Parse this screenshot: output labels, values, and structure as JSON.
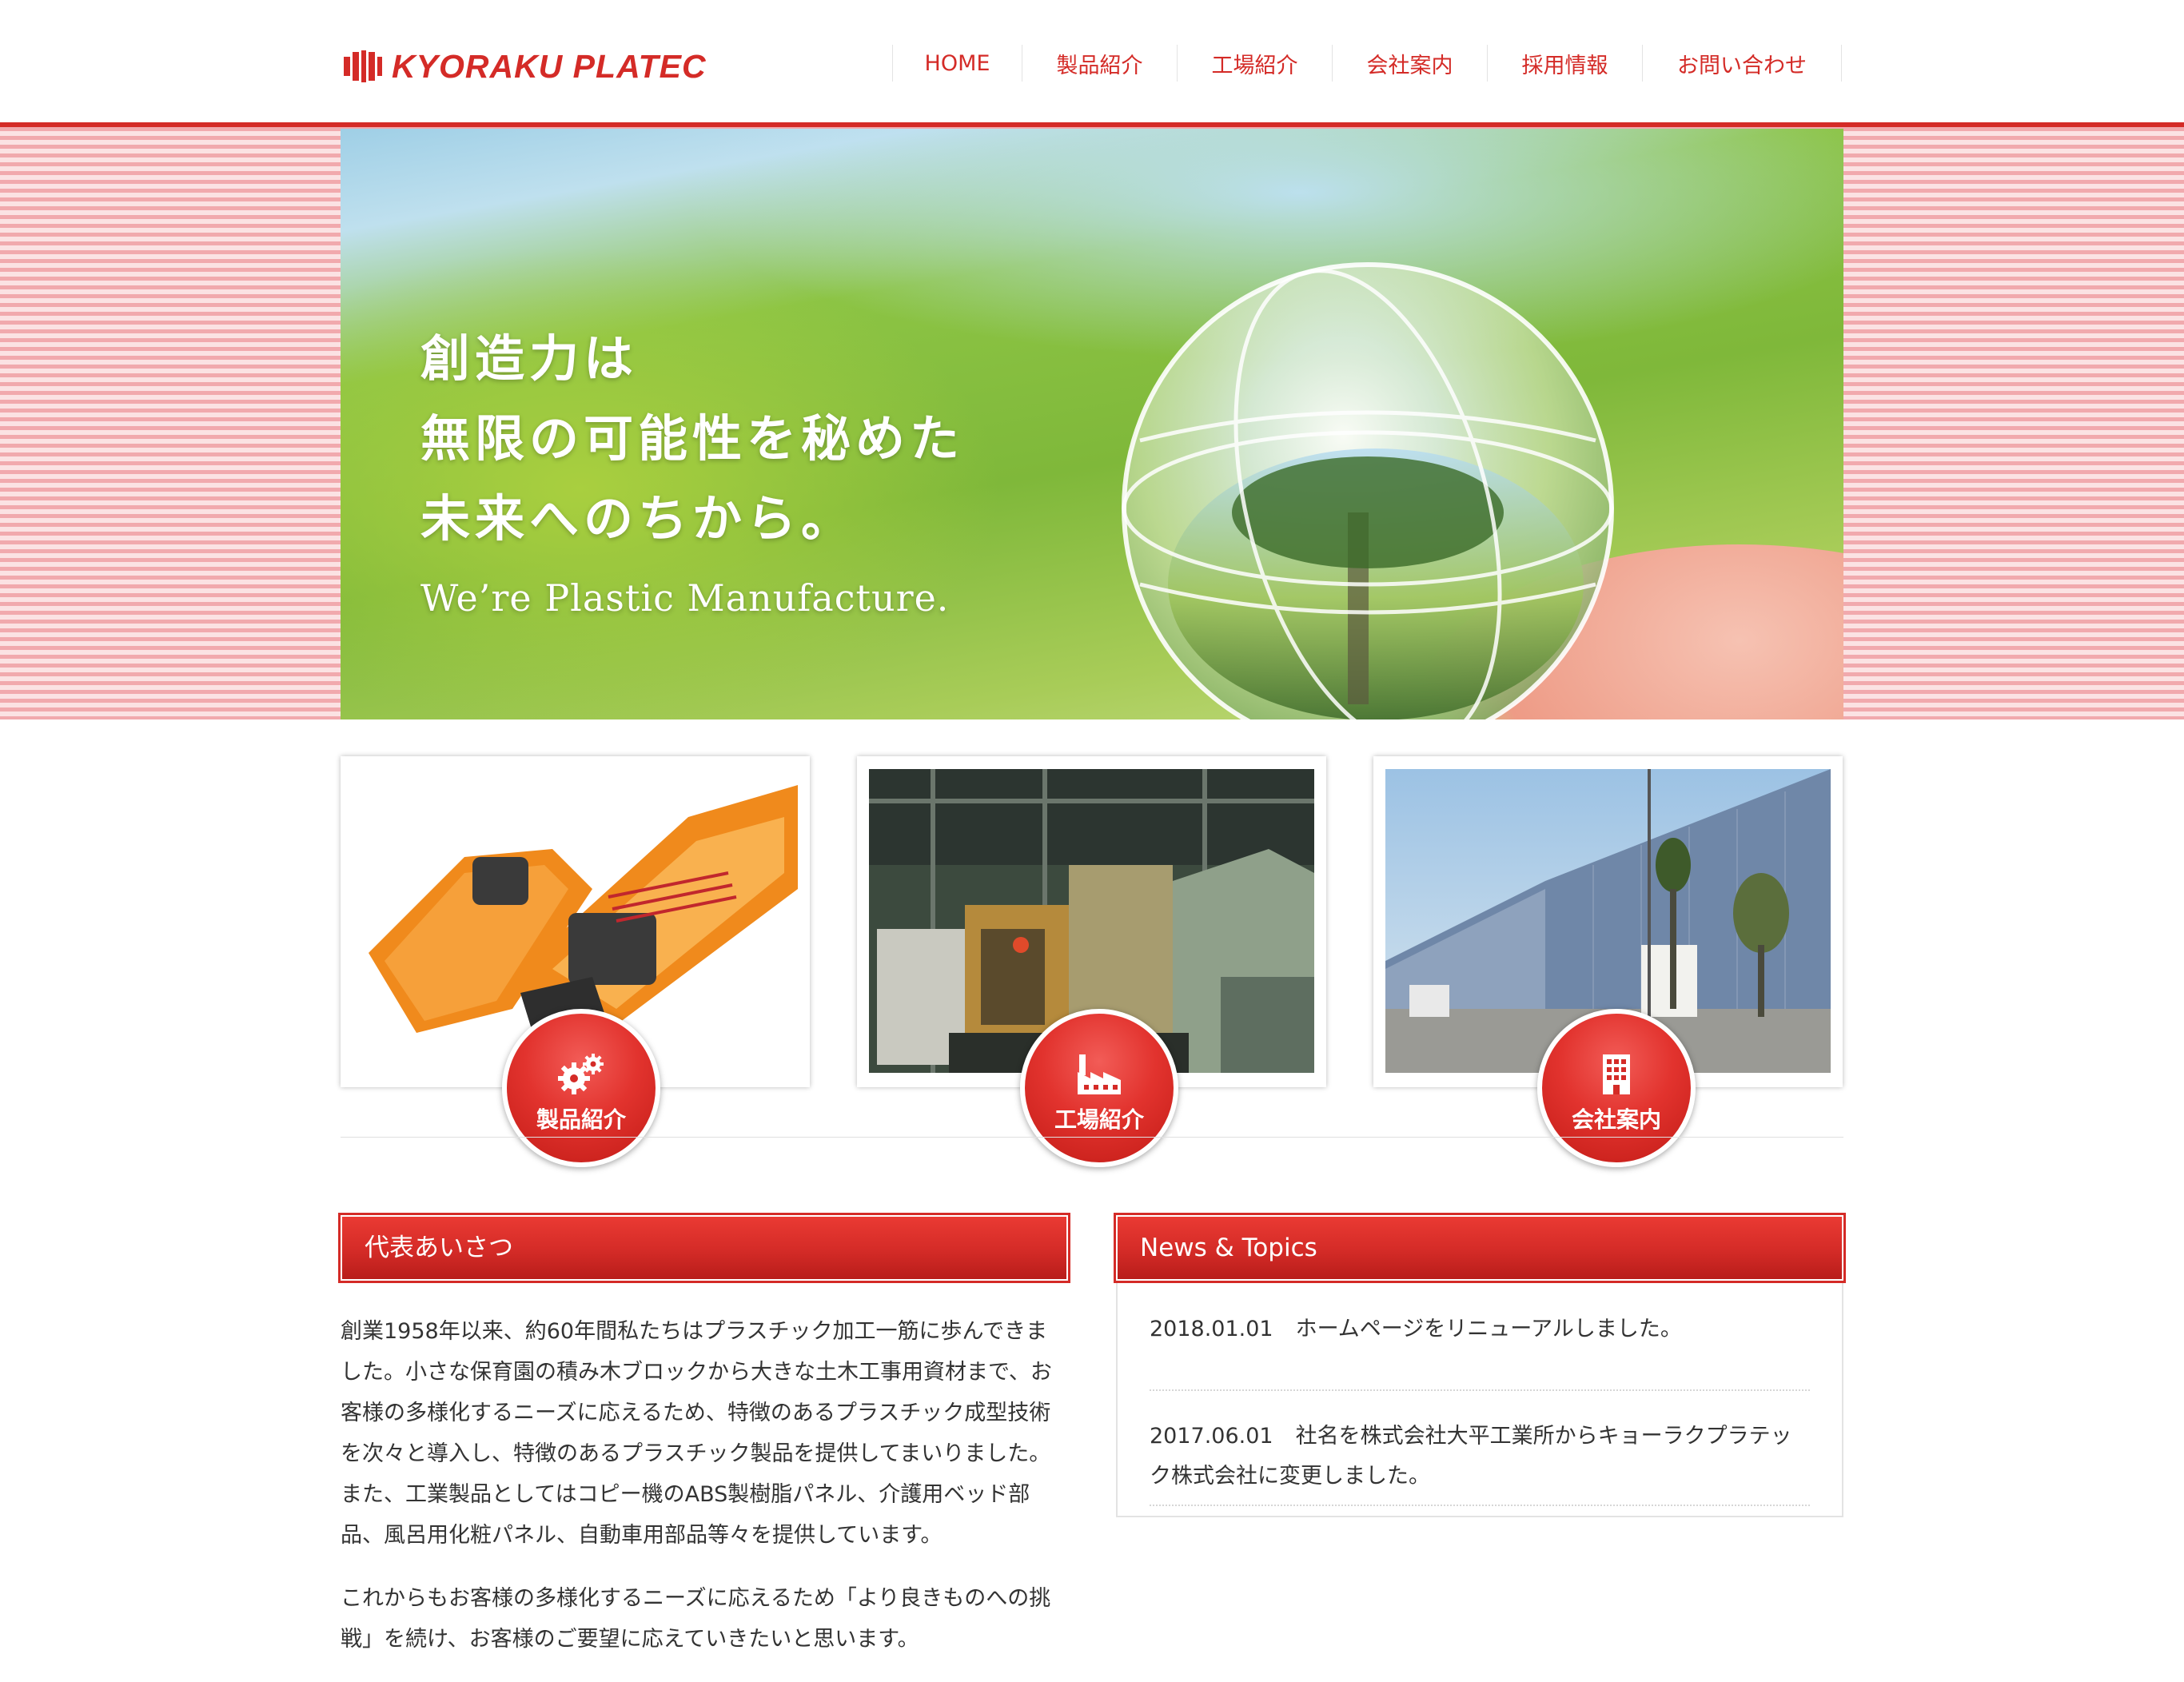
{
  "brand": {
    "name": "KYORAKU PLATEC",
    "color": "#d42b27"
  },
  "nav": {
    "items": [
      {
        "label": "HOME"
      },
      {
        "label": "製品紹介"
      },
      {
        "label": "工場紹介"
      },
      {
        "label": "会社案内"
      },
      {
        "label": "採用情報"
      },
      {
        "label": "お問い合わせ"
      }
    ]
  },
  "hero": {
    "lines": [
      "創造力は",
      "無限の可能性を秘めた",
      "未来へのちから。"
    ],
    "tagline": "We’re Plastic Manufacture."
  },
  "cards": [
    {
      "label": "製品紹介",
      "icon": "gears-icon"
    },
    {
      "label": "工場紹介",
      "icon": "factory-icon"
    },
    {
      "label": "会社案内",
      "icon": "office-building-icon"
    }
  ],
  "greeting": {
    "title": "代表あいさつ",
    "paragraphs": [
      "創業1958年以来、約60年間私たちはプラスチック加工一筋に歩んできました。小さな保育園の積み木ブロックから大きな土木工事用資材まで、お客様の多様化するニーズに応えるため、特徴のあるプラスチック成型技術を次々と導入し、特徴のあるプラスチック製品を提供してまいりました。また、工業製品としてはコピー機のABS製樹脂パネル、介護用ベッド部品、風呂用化粧パネル、自動車用部品等々を提供しています。",
      "これからもお客様の多様化するニーズに応えるため「より良きものへの挑戦」を続け、お客様のご要望に応えていきたいと思います。"
    ]
  },
  "news": {
    "title": "News & Topics",
    "items": [
      {
        "date": "2018.01.01",
        "text": "ホームページをリニューアルしました。"
      },
      {
        "date": "2017.06.01",
        "text": "社名を株式会社大平工業所からキョーラクプラテック株式会社に変更しました。"
      }
    ]
  }
}
